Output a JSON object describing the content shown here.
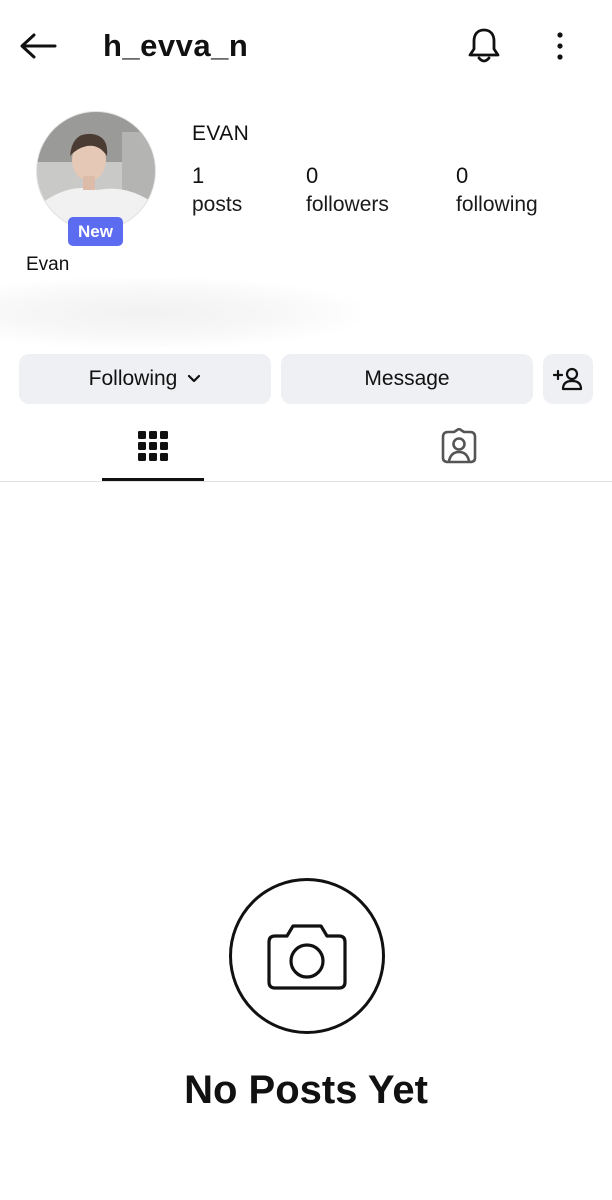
{
  "header": {
    "username": "h_evva_n",
    "back_icon": "arrow-left-icon",
    "notifications_icon": "bell-icon",
    "more_icon": "more-vertical-icon"
  },
  "profile": {
    "display_name": "EVAN",
    "new_badge": "New",
    "bio_name": "Evan",
    "stats": {
      "posts_count": "1",
      "posts_label": "posts",
      "followers_count": "0",
      "followers_label": "followers",
      "following_count": "0",
      "following_label": "following"
    }
  },
  "actions": {
    "following_label": "Following",
    "message_label": "Message",
    "add_user_icon": "add-user-icon"
  },
  "tabs": [
    {
      "id": "grid",
      "icon": "grid-icon",
      "active": true
    },
    {
      "id": "tagged",
      "icon": "tagged-person-icon",
      "active": false
    }
  ],
  "empty_state": {
    "icon": "camera-icon",
    "title": "No Posts Yet"
  },
  "colors": {
    "badge": "#5b6cf0",
    "button_bg": "#eef0f3",
    "text": "#111111"
  }
}
